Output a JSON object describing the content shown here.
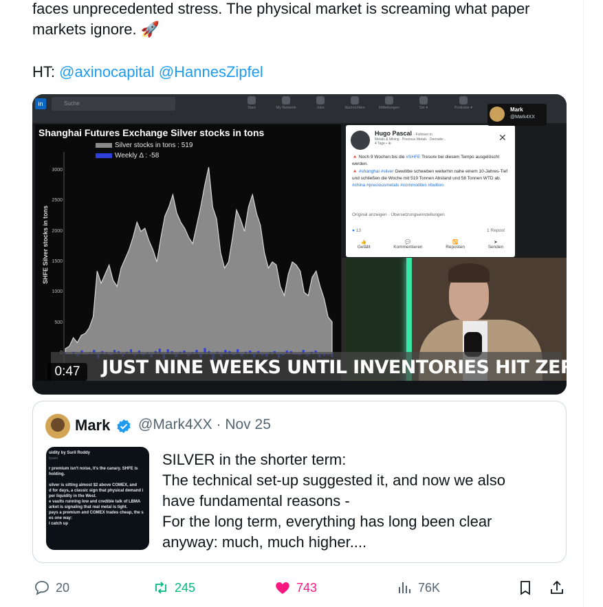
{
  "tweet": {
    "text_lines": [
      "faces unprecedented stress. The physical market is screaming what paper",
      "markets ignore. 🚀"
    ],
    "ht_prefix": "HT: ",
    "mentions": [
      "@axinocapital",
      "@HannesZipfel"
    ]
  },
  "video": {
    "timestamp": "0:47",
    "subtitle": "JUST NINE WEEKS UNTIL INVENTORIES HIT ZERO.",
    "search_placeholder": "Suche",
    "nav_items": [
      "Start",
      "My Network",
      "Jobs",
      "Nachrichten",
      "Mitteilungen",
      "Sie ▾",
      "Produkte ▾"
    ],
    "overlay_user": {
      "name": "Mark",
      "handle": "@Mark4XX"
    },
    "fb_post": {
      "author": "Hugo Pascal",
      "author_suffix": "· Follower:in",
      "meta": "Metals & Mining · Precious Metals · Derivativ...",
      "age": "4 Tage •",
      "body_line1": "🔺 Noch 9 Wochen bis die ",
      "body_tag1": "#SHFE",
      "body_line1b": " Tresore bei diesem Tempo ausgelöscht werden.",
      "body_line2_tag1": "#shanghai",
      "body_line2_tag2": "#silver",
      "body_line2": " Gewölbe schweben weiterhin nahe einem 10-Jahres-Tief und schließen die Woche mit 519 Tonnen Abstand und 58 Tonnen WTD ab.",
      "hashtags": "#china #preciousmetals #commodites #bullion",
      "links": "Original anzeigen  ·  Übersetzungseinstellungen",
      "reactions": "13",
      "reposts": "1 Repost",
      "actions": [
        "Gefällt",
        "Kommentieren",
        "Reposten",
        "Senden"
      ]
    }
  },
  "chart_data": {
    "type": "area",
    "title": "Shanghai Futures Exchange Silver stocks in tons",
    "ylabel": "SHFE Silver stocks in tons",
    "legend": [
      "Silver stocks in tons : 519",
      "Weekly Δ : -58"
    ],
    "ylim": [
      -300,
      3300
    ],
    "yticks": [
      0,
      500,
      1000,
      1500,
      2000,
      2500,
      3000
    ],
    "series": [
      {
        "name": "Silver stocks in tons",
        "values": [
          80,
          120,
          260,
          180,
          300,
          330,
          420,
          600,
          1350,
          1150,
          1300,
          1450,
          1200,
          1100,
          1400,
          1550,
          1700,
          1900,
          2150,
          2000,
          2050,
          1850,
          1700,
          1500,
          1900,
          2250,
          2400,
          2600,
          2300,
          2150,
          2050,
          1900,
          1800,
          2100,
          2400,
          2750,
          3050,
          2400,
          2200,
          1650,
          1400,
          1500,
          1900,
          2350,
          2200,
          2000,
          2400,
          2600,
          2300,
          2100,
          1650,
          1400,
          1500,
          1450,
          1100,
          950,
          1300,
          1500,
          1450,
          1350,
          1000,
          950,
          1250,
          1350,
          1100,
          900,
          600,
          519
        ]
      },
      {
        "name": "Weekly Δ",
        "values": [
          20,
          -10,
          30,
          -40,
          50,
          -20,
          10,
          60,
          -80,
          40,
          20,
          -30,
          60,
          40,
          -50,
          30,
          70,
          -40,
          50,
          -30,
          20,
          -60,
          40,
          80,
          -90,
          70,
          40,
          -60,
          30,
          50,
          -40,
          20,
          60,
          -70,
          90,
          40,
          -120,
          30,
          -50,
          60,
          40,
          -30,
          70,
          -40,
          30,
          50,
          -60,
          40,
          -30,
          -50,
          20,
          40,
          -70,
          -30,
          50,
          40,
          -20,
          -30,
          60,
          -40,
          30,
          50,
          -60,
          -40,
          -30,
          -58
        ]
      }
    ],
    "colors": {
      "stock": "#8a8a8a",
      "weekly": "#2f3fd9"
    }
  },
  "quote": {
    "name": "Mark",
    "handle_date": "@Mark4XX · Nov 25",
    "thumb_title": "uidity by Suril Roddy",
    "thumb_sub": "lysant",
    "thumb_lines": [
      "r premium isn't noise, it's the canary. SHFE is",
      "holding.",
      "",
      "silver is sitting almost $2 above COMEX, and",
      "d for days, a classic sign that physical demand i",
      "per liquidity in the West.",
      "e vaults running low and credible talk of LBMA",
      "arket is signaling that real metal is tight.",
      "pays a premium and COMEX trades cheap, the s",
      "es one way:",
      "l catch up"
    ],
    "text_lines": [
      "SILVER in the shorter term:",
      "The technical set-up suggested it, and now we also",
      "have fundamental reasons -",
      "For the long term, everything has long been clear",
      "anyway: much, much higher...."
    ]
  },
  "actions": {
    "replies": "20",
    "retweets": "245",
    "likes": "743",
    "views": "76K"
  }
}
